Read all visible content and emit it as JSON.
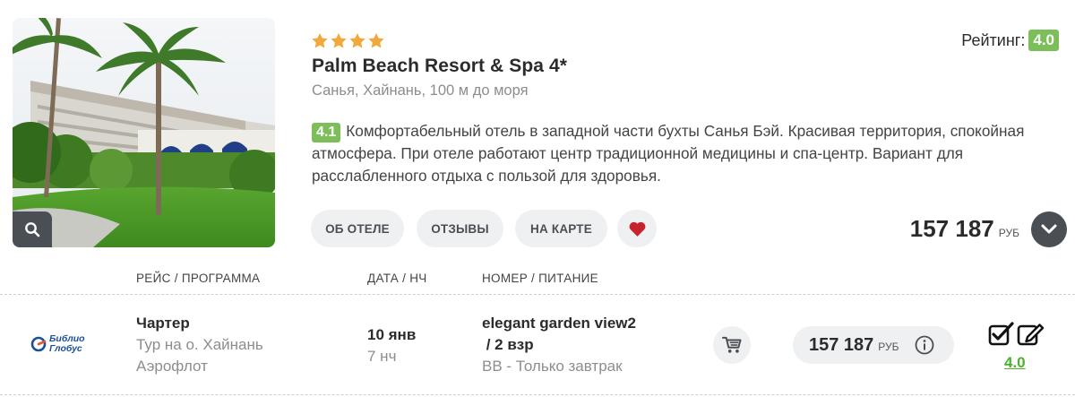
{
  "hotel": {
    "stars": 4,
    "name": "Palm Beach Resort & Spa 4*",
    "location": "Санья, Хайнань, 100 м до моря",
    "rating_label": "Рейтинг:",
    "rating_value": "4.0",
    "review_score": "4.1",
    "description": "Комфортабельный отель в западной части бухты Санья Бэй. Красивая территория, спокойная атмосфера. При отеле работают центр традиционной медицины и спа-центр. Вариант для расслабленного отдыха с пользой для здоровья.",
    "price": "157 187",
    "currency": "РУБ"
  },
  "buttons": {
    "about": "ОБ ОТЕЛЕ",
    "reviews": "ОТЗЫВЫ",
    "map": "НА КАРТЕ"
  },
  "icons": {
    "zoom": "search-icon",
    "favorite": "heart-icon",
    "expand": "chevron-down-icon",
    "cart": "cart-icon",
    "info": "info-icon",
    "checkbox": "checkbox-checked-icon",
    "edit": "edit-icon",
    "star": "star-icon"
  },
  "colors": {
    "badge_green": "#7cbf5a",
    "star": "#f0a93a",
    "heart": "#c8232c",
    "rating_link": "#4caf30",
    "dark_button": "#4a4f55"
  },
  "table": {
    "headers": {
      "flight": "РЕЙС / ПРОГРАММА",
      "date": "ДАТА / НЧ",
      "room": "НОМЕР / ПИТАНИЕ"
    },
    "row": {
      "operator_logo_line1": "Библио",
      "operator_logo_line2": "Глобус",
      "flight_type": "Чартер",
      "program": "Тур на о. Хайнань",
      "airline": "Аэрофлот",
      "date": "10 янв",
      "nights": "7 нч",
      "room_line1": "elegant garden view2",
      "room_line2": " / 2 взр",
      "meal": "BB - Только завтрак",
      "price": "157 187",
      "currency": "РУБ",
      "rating": "4.0"
    }
  }
}
